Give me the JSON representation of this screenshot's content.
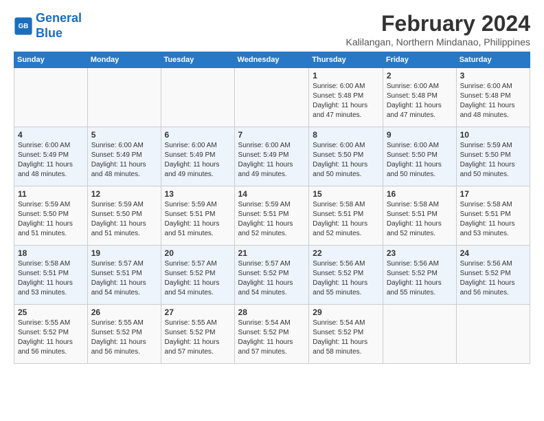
{
  "logo": {
    "line1": "General",
    "line2": "Blue"
  },
  "title": "February 2024",
  "location": "Kalilangan, Northern Mindanao, Philippines",
  "days_of_week": [
    "Sunday",
    "Monday",
    "Tuesday",
    "Wednesday",
    "Thursday",
    "Friday",
    "Saturday"
  ],
  "weeks": [
    [
      {
        "day": "",
        "detail": ""
      },
      {
        "day": "",
        "detail": ""
      },
      {
        "day": "",
        "detail": ""
      },
      {
        "day": "",
        "detail": ""
      },
      {
        "day": "1",
        "detail": "Sunrise: 6:00 AM\nSunset: 5:48 PM\nDaylight: 11 hours\nand 47 minutes."
      },
      {
        "day": "2",
        "detail": "Sunrise: 6:00 AM\nSunset: 5:48 PM\nDaylight: 11 hours\nand 47 minutes."
      },
      {
        "day": "3",
        "detail": "Sunrise: 6:00 AM\nSunset: 5:48 PM\nDaylight: 11 hours\nand 48 minutes."
      }
    ],
    [
      {
        "day": "4",
        "detail": "Sunrise: 6:00 AM\nSunset: 5:49 PM\nDaylight: 11 hours\nand 48 minutes."
      },
      {
        "day": "5",
        "detail": "Sunrise: 6:00 AM\nSunset: 5:49 PM\nDaylight: 11 hours\nand 48 minutes."
      },
      {
        "day": "6",
        "detail": "Sunrise: 6:00 AM\nSunset: 5:49 PM\nDaylight: 11 hours\nand 49 minutes."
      },
      {
        "day": "7",
        "detail": "Sunrise: 6:00 AM\nSunset: 5:49 PM\nDaylight: 11 hours\nand 49 minutes."
      },
      {
        "day": "8",
        "detail": "Sunrise: 6:00 AM\nSunset: 5:50 PM\nDaylight: 11 hours\nand 50 minutes."
      },
      {
        "day": "9",
        "detail": "Sunrise: 6:00 AM\nSunset: 5:50 PM\nDaylight: 11 hours\nand 50 minutes."
      },
      {
        "day": "10",
        "detail": "Sunrise: 5:59 AM\nSunset: 5:50 PM\nDaylight: 11 hours\nand 50 minutes."
      }
    ],
    [
      {
        "day": "11",
        "detail": "Sunrise: 5:59 AM\nSunset: 5:50 PM\nDaylight: 11 hours\nand 51 minutes."
      },
      {
        "day": "12",
        "detail": "Sunrise: 5:59 AM\nSunset: 5:50 PM\nDaylight: 11 hours\nand 51 minutes."
      },
      {
        "day": "13",
        "detail": "Sunrise: 5:59 AM\nSunset: 5:51 PM\nDaylight: 11 hours\nand 51 minutes."
      },
      {
        "day": "14",
        "detail": "Sunrise: 5:59 AM\nSunset: 5:51 PM\nDaylight: 11 hours\nand 52 minutes."
      },
      {
        "day": "15",
        "detail": "Sunrise: 5:58 AM\nSunset: 5:51 PM\nDaylight: 11 hours\nand 52 minutes."
      },
      {
        "day": "16",
        "detail": "Sunrise: 5:58 AM\nSunset: 5:51 PM\nDaylight: 11 hours\nand 52 minutes."
      },
      {
        "day": "17",
        "detail": "Sunrise: 5:58 AM\nSunset: 5:51 PM\nDaylight: 11 hours\nand 53 minutes."
      }
    ],
    [
      {
        "day": "18",
        "detail": "Sunrise: 5:58 AM\nSunset: 5:51 PM\nDaylight: 11 hours\nand 53 minutes."
      },
      {
        "day": "19",
        "detail": "Sunrise: 5:57 AM\nSunset: 5:51 PM\nDaylight: 11 hours\nand 54 minutes."
      },
      {
        "day": "20",
        "detail": "Sunrise: 5:57 AM\nSunset: 5:52 PM\nDaylight: 11 hours\nand 54 minutes."
      },
      {
        "day": "21",
        "detail": "Sunrise: 5:57 AM\nSunset: 5:52 PM\nDaylight: 11 hours\nand 54 minutes."
      },
      {
        "day": "22",
        "detail": "Sunrise: 5:56 AM\nSunset: 5:52 PM\nDaylight: 11 hours\nand 55 minutes."
      },
      {
        "day": "23",
        "detail": "Sunrise: 5:56 AM\nSunset: 5:52 PM\nDaylight: 11 hours\nand 55 minutes."
      },
      {
        "day": "24",
        "detail": "Sunrise: 5:56 AM\nSunset: 5:52 PM\nDaylight: 11 hours\nand 56 minutes."
      }
    ],
    [
      {
        "day": "25",
        "detail": "Sunrise: 5:55 AM\nSunset: 5:52 PM\nDaylight: 11 hours\nand 56 minutes."
      },
      {
        "day": "26",
        "detail": "Sunrise: 5:55 AM\nSunset: 5:52 PM\nDaylight: 11 hours\nand 56 minutes."
      },
      {
        "day": "27",
        "detail": "Sunrise: 5:55 AM\nSunset: 5:52 PM\nDaylight: 11 hours\nand 57 minutes."
      },
      {
        "day": "28",
        "detail": "Sunrise: 5:54 AM\nSunset: 5:52 PM\nDaylight: 11 hours\nand 57 minutes."
      },
      {
        "day": "29",
        "detail": "Sunrise: 5:54 AM\nSunset: 5:52 PM\nDaylight: 11 hours\nand 58 minutes."
      },
      {
        "day": "",
        "detail": ""
      },
      {
        "day": "",
        "detail": ""
      }
    ]
  ]
}
